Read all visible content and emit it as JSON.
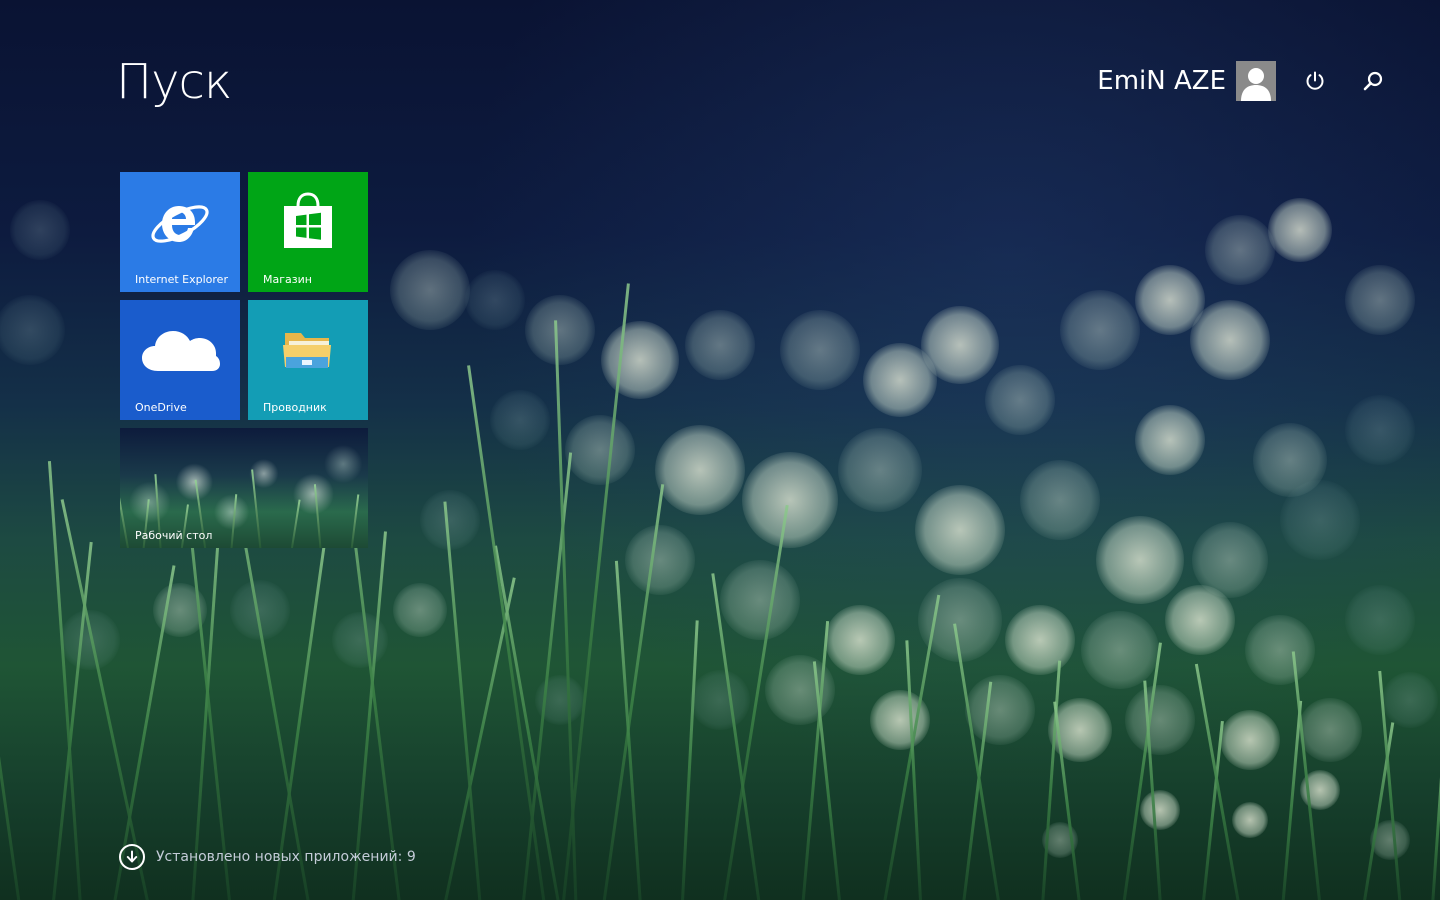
{
  "header": {
    "title": "Пуск",
    "user_name": "EmiN AZE"
  },
  "icons": {
    "avatar": "user-silhouette-icon",
    "power": "power-icon",
    "search": "search-icon",
    "notice": "arrow-down-circle-icon"
  },
  "tiles": [
    {
      "label": "Internet Explorer",
      "color": "#2b7be6",
      "icon": "internet-explorer-icon"
    },
    {
      "label": "Магазин",
      "color": "#00a516",
      "icon": "store-bag-icon"
    },
    {
      "label": "OneDrive",
      "color": "#1a5ccc",
      "icon": "cloud-icon"
    },
    {
      "label": "Проводник",
      "color": "#139db5",
      "icon": "folder-icon"
    },
    {
      "label": "Рабочий стол",
      "icon": "desktop-wallpaper-thumbnail"
    }
  ],
  "notice": {
    "text": "Установлено новых приложений: 9"
  }
}
